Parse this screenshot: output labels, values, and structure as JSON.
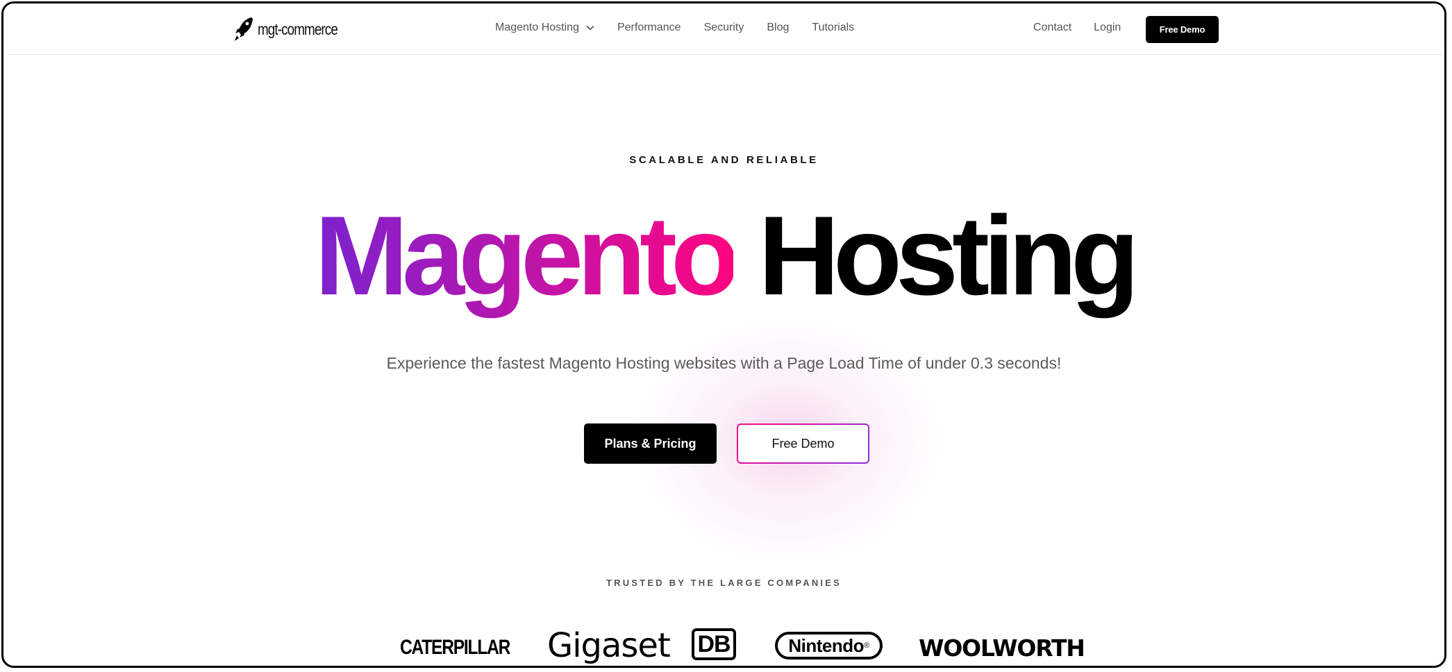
{
  "nav": {
    "logo_text": "mgt-commerce",
    "logo_icon": "rocket-icon",
    "links": [
      {
        "label": "Magento Hosting",
        "has_dropdown": true
      },
      {
        "label": "Performance"
      },
      {
        "label": "Security"
      },
      {
        "label": "Blog"
      },
      {
        "label": "Tutorials"
      }
    ],
    "right_links": [
      {
        "label": "Contact"
      },
      {
        "label": "Login"
      }
    ],
    "cta_label": "Free Demo"
  },
  "hero": {
    "eyebrow": "SCALABLE AND RELIABLE",
    "headline_gradient": "Magento",
    "headline_plain": "Hosting",
    "subtitle": "Experience the fastest Magento Hosting websites with a Page Load Time of under 0.3 seconds!",
    "primary_button": "Plans & Pricing",
    "secondary_button": "Free Demo",
    "gradient_start": "#7b22cf",
    "gradient_end": "#ff0480"
  },
  "trusted": {
    "heading": "TRUSTED BY THE LARGE COMPANIES",
    "logos": [
      "CATERPILLAR",
      "Gigaset",
      "DB",
      "Nintendo",
      "WOOLWORTH"
    ]
  }
}
